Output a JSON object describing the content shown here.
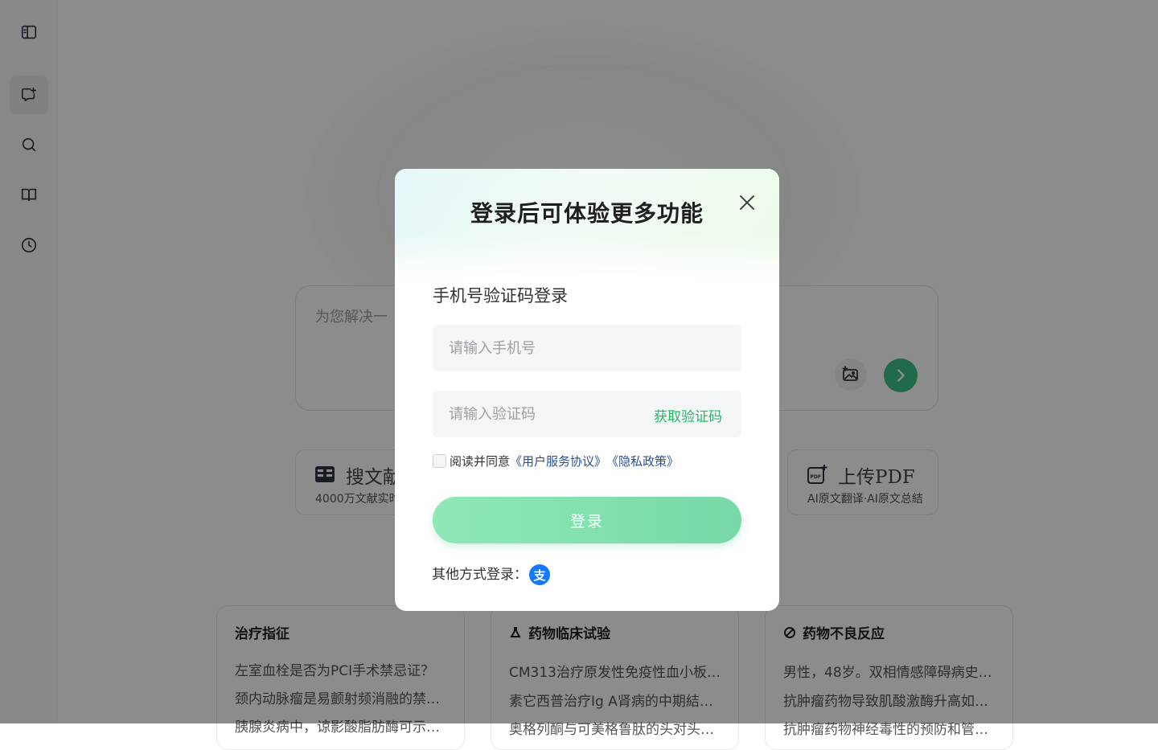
{
  "sidebar": {
    "items": [
      {
        "name": "sidebar-toggle",
        "icon": "panel-toggle-icon"
      },
      {
        "name": "new-chat",
        "icon": "new-chat-icon",
        "active": true
      },
      {
        "name": "search",
        "icon": "search-icon"
      },
      {
        "name": "library",
        "icon": "book-icon"
      },
      {
        "name": "history",
        "icon": "clock-icon"
      }
    ]
  },
  "main": {
    "input_placeholder": "为您解决一",
    "features": [
      {
        "title": "搜文献",
        "subtitle": "4000万文献实时",
        "icon": "literature-icon"
      },
      {
        "title": "上传PDF",
        "subtitle": "AI原文翻译·AI原文总結",
        "icon": "pdf-upload-icon"
      }
    ],
    "recommend": [
      {
        "title": "治疗指征",
        "icon": "",
        "items": [
          "左室血栓是否为PCI手术禁忌证？",
          "颈内动脉瘤是易颤射频消融的禁…",
          "胰腺炎病中，谅影酸脂肪酶可示…"
        ]
      },
      {
        "title": "药物临床试验",
        "icon": "flask-icon",
        "items": [
          "CM313治疗原发性免疫性血小板…",
          "素它西普治疗Ig A肾病的中期結…",
          "奥格列酮与可美格鲁肽的头对头…"
        ]
      },
      {
        "title": "药物不良反应",
        "icon": "pill-icon",
        "items": [
          "男性，48岁。双相情感障碍病史1…",
          "抗肿瘤药物导致肌酸激酶升高如…",
          "抗肿瘤药物神经毒性的预防和管…"
        ]
      }
    ]
  },
  "modal": {
    "title": "登录后可体验更多功能",
    "login_heading": "手机号验证码登录",
    "phone_placeholder": "请输入手机号",
    "code_placeholder": "请输入验证码",
    "get_code": "获取验证码",
    "agree_prefix": "阅读并同意",
    "terms_link": "《用户服务协议》",
    "privacy_link": "《隐私政策》",
    "login_button": "登录",
    "other_login": "其他方式登录：",
    "alipay_glyph": "支"
  },
  "colors": {
    "accent": "#26b768",
    "send_button": "#3cc28a",
    "login_gradient_start": "#8ee8b7",
    "login_gradient_end": "#78d8a7",
    "alipay": "#1677ff",
    "overlay": "rgba(0,0,0,0.45)"
  }
}
